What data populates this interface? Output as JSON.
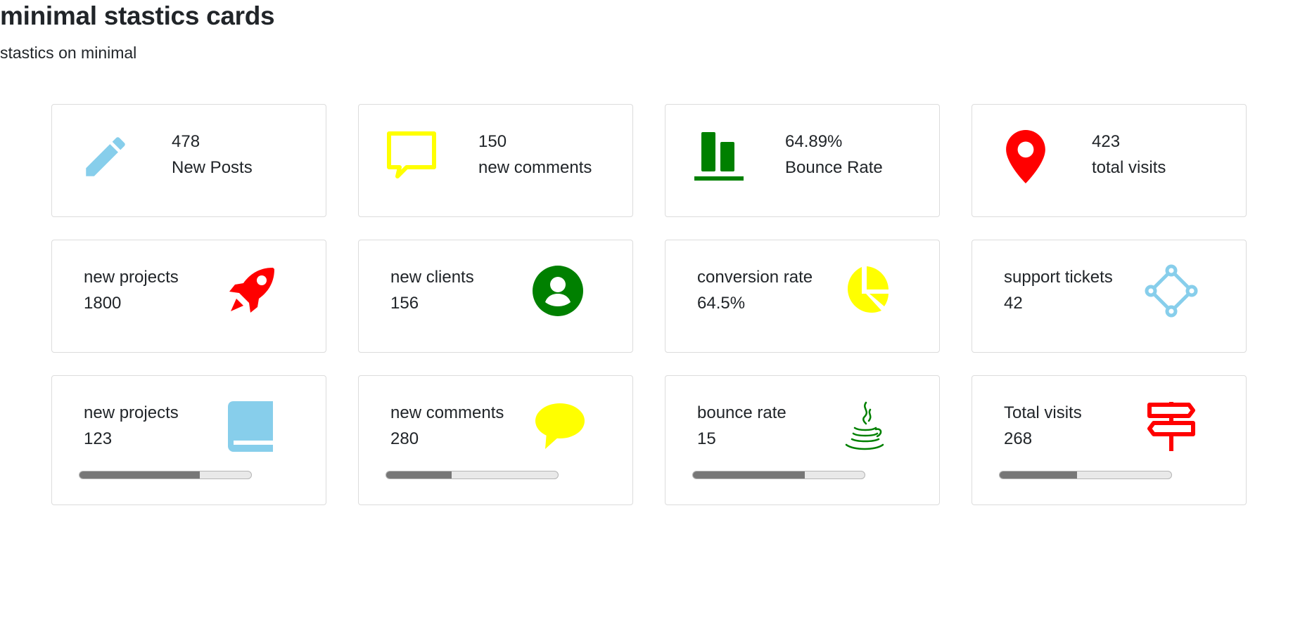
{
  "page": {
    "title": "minimal stastics cards",
    "subtitle": "stastics on minimal"
  },
  "colors": {
    "skyblue": "#87ceeb",
    "yellow": "#ffff00",
    "green": "#008000",
    "red": "#ff0000"
  },
  "row1": [
    {
      "value": "478",
      "label": "New Posts",
      "icon": "pencil-icon"
    },
    {
      "value": "150",
      "label": "new comments",
      "icon": "chat-bubble-icon"
    },
    {
      "value": "64.89%",
      "label": "Bounce Rate",
      "icon": "bar-chart-icon"
    },
    {
      "value": "423",
      "label": "total visits",
      "icon": "map-pin-icon"
    }
  ],
  "row2": [
    {
      "label": "new projects",
      "value": "1800",
      "icon": "rocket-icon"
    },
    {
      "label": "new clients",
      "value": "156",
      "icon": "user-circle-icon"
    },
    {
      "label": "conversion rate",
      "value": "64.5%",
      "icon": "pie-chart-icon"
    },
    {
      "label": "support tickets",
      "value": "42",
      "icon": "network-nodes-icon"
    }
  ],
  "row3": [
    {
      "label": "new projects",
      "value": "123",
      "icon": "book-icon",
      "progress": 0.7
    },
    {
      "label": "new comments",
      "value": "280",
      "icon": "speech-bubble-icon",
      "progress": 0.38
    },
    {
      "label": "bounce rate",
      "value": "15",
      "icon": "java-cup-icon",
      "progress": 0.65
    },
    {
      "label": "Total visits",
      "value": "268",
      "icon": "signpost-icon",
      "progress": 0.45
    }
  ]
}
